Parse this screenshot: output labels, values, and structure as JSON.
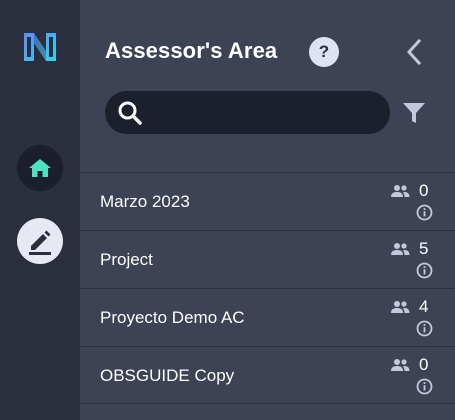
{
  "sidebar": {
    "logo": "app-logo",
    "items": [
      {
        "icon": "home-icon",
        "active": true
      },
      {
        "icon": "edit-icon",
        "active": false
      }
    ]
  },
  "panel": {
    "title": "Assessor's Area",
    "help_label": "?",
    "search": {
      "placeholder": "",
      "value": ""
    }
  },
  "projects": [
    {
      "name": "Marzo 2023",
      "count": "0"
    },
    {
      "name": "Project",
      "count": "5"
    },
    {
      "name": "Proyecto Demo AC",
      "count": "4"
    },
    {
      "name": "OBSGUIDE Copy",
      "count": "0"
    }
  ],
  "colors": {
    "rail_bg": "#2b2f3d",
    "panel_bg": "#3d4254",
    "search_bg": "#1c202c",
    "home_accent": "#4de3c0",
    "icon_muted": "#c3c8dd"
  }
}
